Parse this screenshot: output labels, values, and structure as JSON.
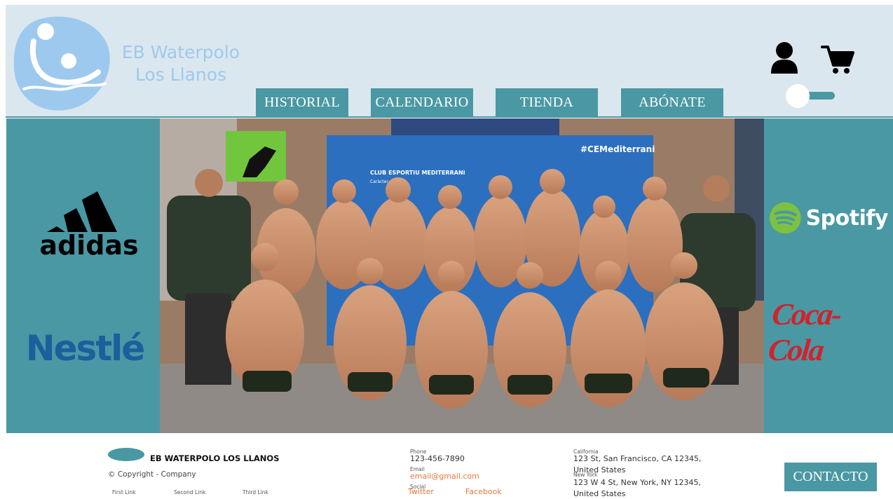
{
  "header": {
    "logo_line1": "EB Waterpolo",
    "logo_line2": "Los Llanos",
    "nav": [
      "HISTORIAL",
      "CALENDARIO",
      "TIENDA",
      "ABÓNATE"
    ]
  },
  "sponsors": {
    "left": [
      "adidas",
      "Nestlé"
    ],
    "right": [
      "Spotify",
      "Coca-Cola"
    ]
  },
  "photo": {
    "backdrop_title": "CLUB ESPORTIU MEDITERRANI",
    "backdrop_sub": "Caràcter andaluz",
    "hashtag": "#CEMediterrani"
  },
  "footer": {
    "brand": "EB WATERPOLO LOS LLANOS",
    "copyright": "© Copyright - Company",
    "links": [
      "First Link",
      "Second Link",
      "Third Link"
    ],
    "phone_label": "Phone",
    "phone": "123-456-7890",
    "email_label": "Email",
    "email": "email@gmail.com",
    "social_label": "Social",
    "social": [
      "Twitter",
      "Facebook"
    ],
    "loc1_label": "California",
    "loc1_a": "123 St, San Francisco, CA 12345,",
    "loc1_b": "United States",
    "loc2_label": "New York",
    "loc2_a": "123 W 4 St, New York, NY 12345,",
    "loc2_b": "United States",
    "contact": "CONTACTO"
  },
  "colors": {
    "accent": "#4a98a4",
    "header_bg": "#dbe7ef",
    "logo_blue": "#9ec9ee",
    "link_orange": "#e47a3a"
  }
}
